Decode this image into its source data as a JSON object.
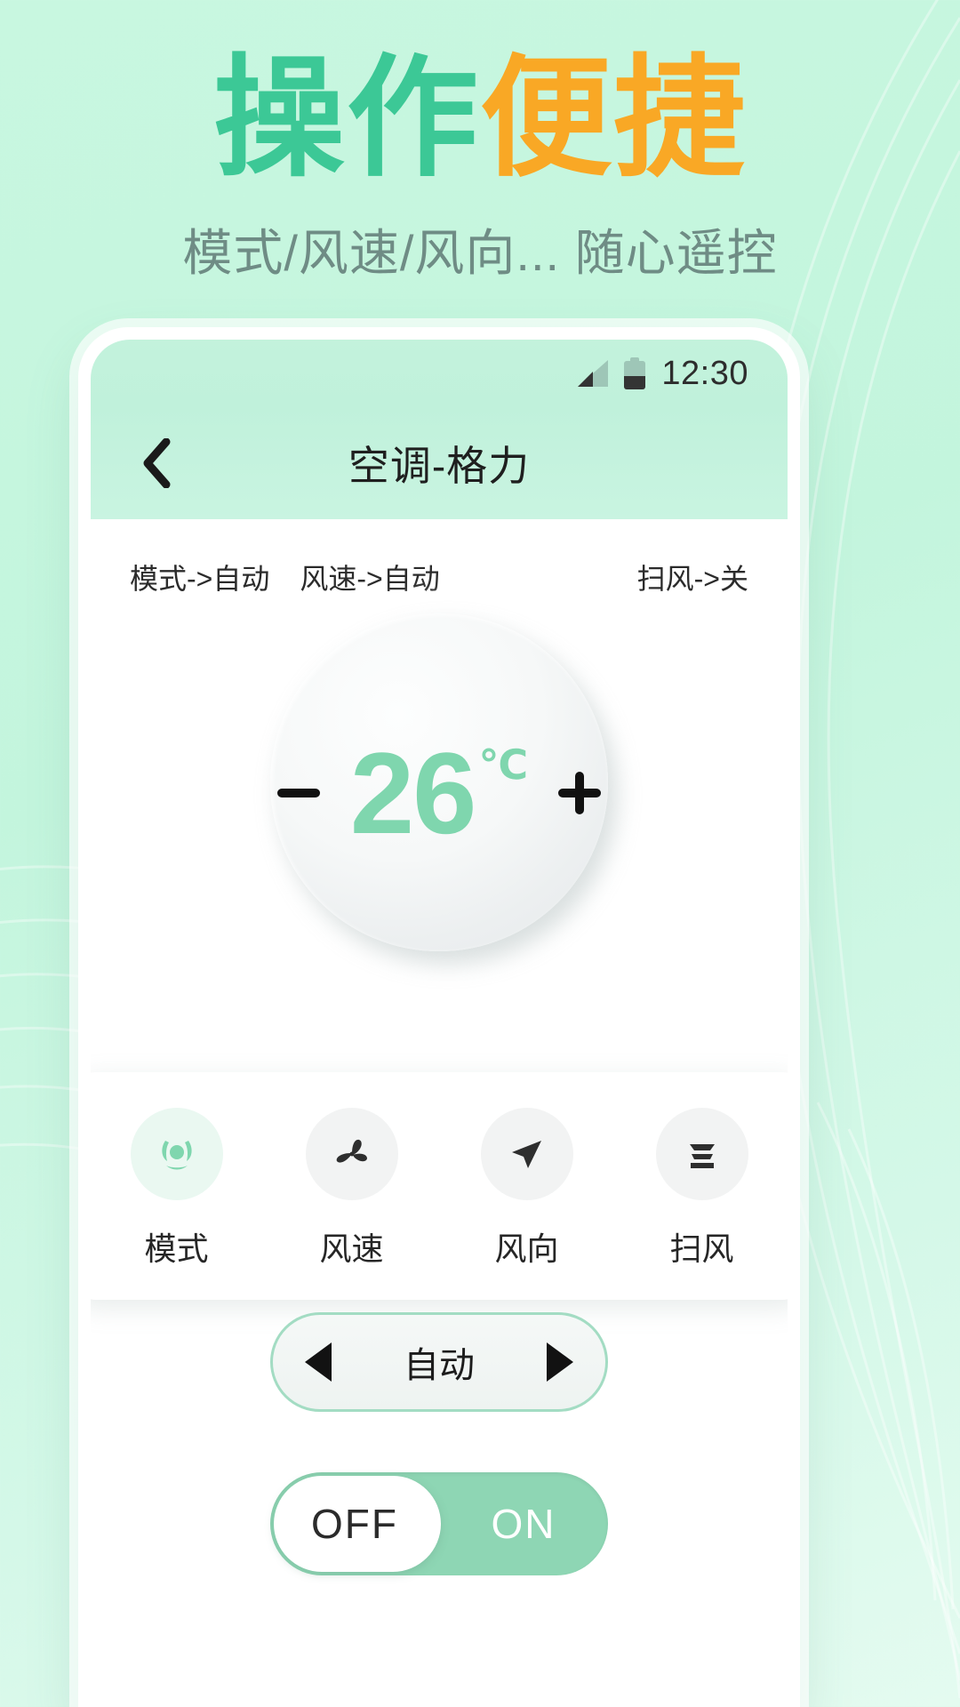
{
  "promo": {
    "headline_green": "操作",
    "headline_orange": "便捷",
    "subtitle": "模式/风速/风向... 随心遥控",
    "accent_green": "#3cc896",
    "accent_orange": "#f9a825",
    "bg_green": "#c8f7e0"
  },
  "phone": {
    "statusbar": {
      "signal_icon": "signal-icon",
      "battery_icon": "battery-icon",
      "clock": "12:30"
    },
    "navbar": {
      "back_icon": "back-chevron-icon",
      "title": "空调-格力"
    },
    "status_row": {
      "mode": "模式->自动",
      "fan_speed": "风速->自动",
      "swing": "扫风->关"
    },
    "dial": {
      "minus_label": "−",
      "plus_label": "+",
      "temperature": "26",
      "unit": "℃",
      "temp_color": "#7fd6ae"
    },
    "functions": [
      {
        "label": "模式",
        "icon": "mode-auto-icon",
        "active": true
      },
      {
        "label": "风速",
        "icon": "fan-propeller-icon",
        "active": false
      },
      {
        "label": "风向",
        "icon": "navigation-arrow-icon",
        "active": false
      },
      {
        "label": "扫风",
        "icon": "swing-lines-icon",
        "active": false
      }
    ],
    "stepper": {
      "prev_icon": "triangle-left-icon",
      "value": "自动",
      "next_icon": "triangle-right-icon"
    },
    "power_toggle": {
      "off_label": "OFF",
      "on_label": "ON",
      "state": "OFF",
      "track_color": "#8ed6b4"
    }
  }
}
